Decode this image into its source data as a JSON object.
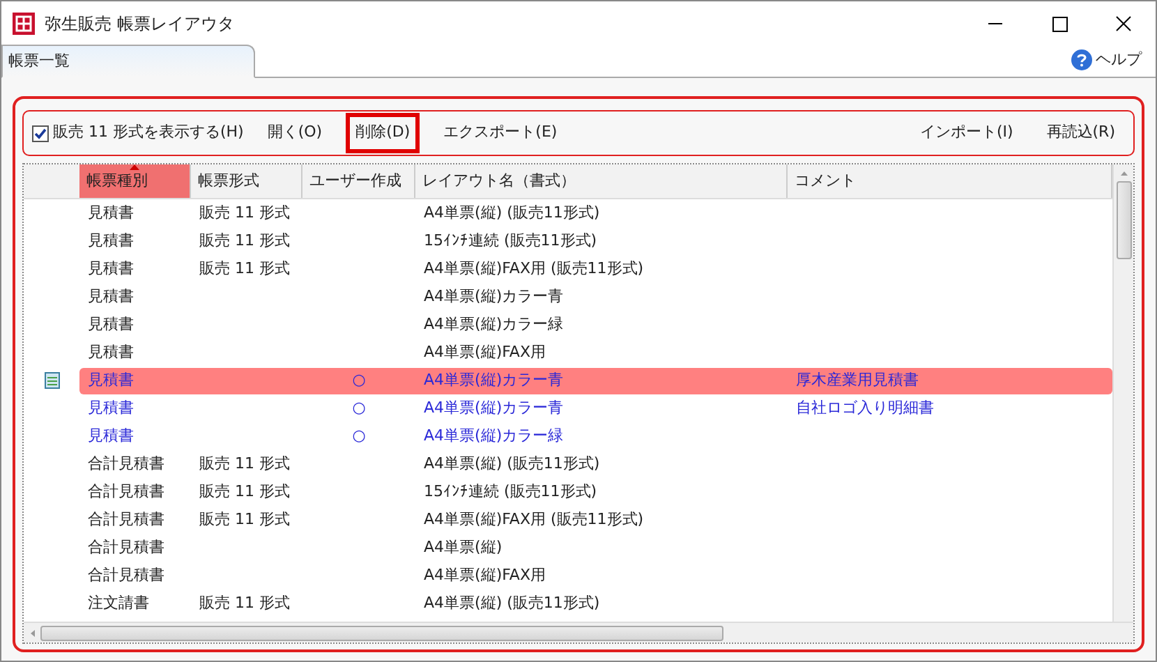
{
  "window": {
    "title": "弥生販売 帳票レイアウタ"
  },
  "tabs": [
    {
      "label": "帳票一覧",
      "selected": true
    }
  ],
  "help": {
    "label": "ヘルプ"
  },
  "toolbar": {
    "checkbox": {
      "label": "販売 11 形式を表示する(H)",
      "checked": true
    },
    "left_buttons": [
      {
        "label": "開く(O)",
        "highlighted": false
      },
      {
        "label": "削除(D)",
        "highlighted": true
      },
      {
        "label": "エクスポート(E)",
        "highlighted": false
      }
    ],
    "right_buttons": [
      {
        "label": "インポート(I)",
        "highlighted": false
      },
      {
        "label": "再読込(R)",
        "highlighted": false
      }
    ]
  },
  "table": {
    "columns": [
      {
        "label": "帳票種別",
        "sorted": true
      },
      {
        "label": "帳票形式",
        "sorted": false
      },
      {
        "label": "ユーザー作成",
        "sorted": false
      },
      {
        "label": "レイアウト名（書式）",
        "sorted": false
      },
      {
        "label": "コメント",
        "sorted": false
      }
    ],
    "rows": [
      {
        "cells": [
          "見積書",
          "販売 11 形式",
          "",
          "A4単票(縦) (販売11形式)",
          ""
        ],
        "custom": false,
        "selected": false
      },
      {
        "cells": [
          "見積書",
          "販売 11 形式",
          "",
          "15ｲﾝﾁ連続 (販売11形式)",
          ""
        ],
        "custom": false,
        "selected": false
      },
      {
        "cells": [
          "見積書",
          "販売 11 形式",
          "",
          "A4単票(縦)FAX用 (販売11形式)",
          ""
        ],
        "custom": false,
        "selected": false
      },
      {
        "cells": [
          "見積書",
          "",
          "",
          "A4単票(縦)カラー青",
          ""
        ],
        "custom": false,
        "selected": false
      },
      {
        "cells": [
          "見積書",
          "",
          "",
          "A4単票(縦)カラー緑",
          ""
        ],
        "custom": false,
        "selected": false
      },
      {
        "cells": [
          "見積書",
          "",
          "",
          "A4単票(縦)FAX用",
          ""
        ],
        "custom": false,
        "selected": false
      },
      {
        "cells": [
          "見積書",
          "",
          "○",
          "A4単票(縦)カラー青",
          "厚木産業用見積書"
        ],
        "custom": true,
        "selected": true
      },
      {
        "cells": [
          "見積書",
          "",
          "○",
          "A4単票(縦)カラー青",
          "自社ロゴ入り明細書"
        ],
        "custom": true,
        "selected": false
      },
      {
        "cells": [
          "見積書",
          "",
          "○",
          "A4単票(縦)カラー緑",
          ""
        ],
        "custom": true,
        "selected": false
      },
      {
        "cells": [
          "合計見積書",
          "販売 11 形式",
          "",
          "A4単票(縦) (販売11形式)",
          ""
        ],
        "custom": false,
        "selected": false
      },
      {
        "cells": [
          "合計見積書",
          "販売 11 形式",
          "",
          "15ｲﾝﾁ連続 (販売11形式)",
          ""
        ],
        "custom": false,
        "selected": false
      },
      {
        "cells": [
          "合計見積書",
          "販売 11 形式",
          "",
          "A4単票(縦)FAX用 (販売11形式)",
          ""
        ],
        "custom": false,
        "selected": false
      },
      {
        "cells": [
          "合計見積書",
          "",
          "",
          "A4単票(縦)",
          ""
        ],
        "custom": false,
        "selected": false
      },
      {
        "cells": [
          "合計見積書",
          "",
          "",
          "A4単票(縦)FAX用",
          ""
        ],
        "custom": false,
        "selected": false
      },
      {
        "cells": [
          "注文請書",
          "販売 11 形式",
          "",
          "A4単票(縦) (販売11形式)",
          ""
        ],
        "custom": false,
        "selected": false
      }
    ]
  }
}
